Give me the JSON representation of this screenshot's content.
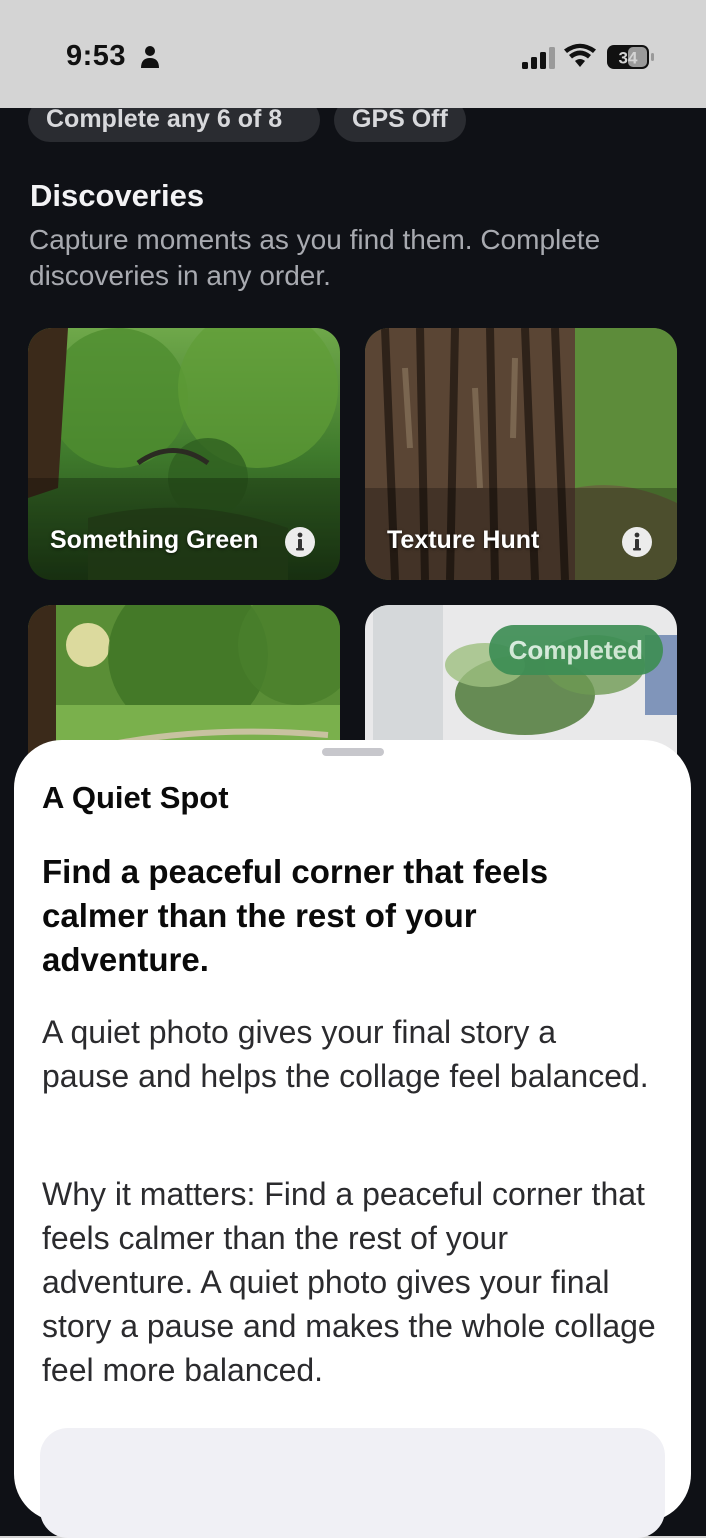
{
  "status_bar": {
    "time": "9:53",
    "battery": "34",
    "icons": [
      "person-icon",
      "signal-icon",
      "wifi-icon",
      "battery-icon"
    ]
  },
  "chips": [
    {
      "label": "Complete any 6 of 8"
    },
    {
      "label": "GPS Off"
    }
  ],
  "discoveries": {
    "title": "Discoveries",
    "subtitle": "Capture moments as you find them. Complete discoveries in any order."
  },
  "cards": [
    {
      "label": "Something Green",
      "icon": "info-icon"
    },
    {
      "label": "Texture Hunt",
      "icon": "info-icon"
    },
    {
      "label": ""
    },
    {
      "label": "",
      "badge": "Completed",
      "badge_color": "#3e8e55"
    }
  ],
  "sheet": {
    "title": "A Quiet Spot",
    "headline": "Find a peaceful corner that feels calmer than the rest of your adventure.",
    "body": "A quiet photo gives your final story a pause and helps the collage feel balanced.",
    "why": "Why it matters: Find a peaceful corner that feels calmer than the rest of your adventure. A quiet photo gives your final story a pause and makes the whole collage feel more balanced."
  }
}
